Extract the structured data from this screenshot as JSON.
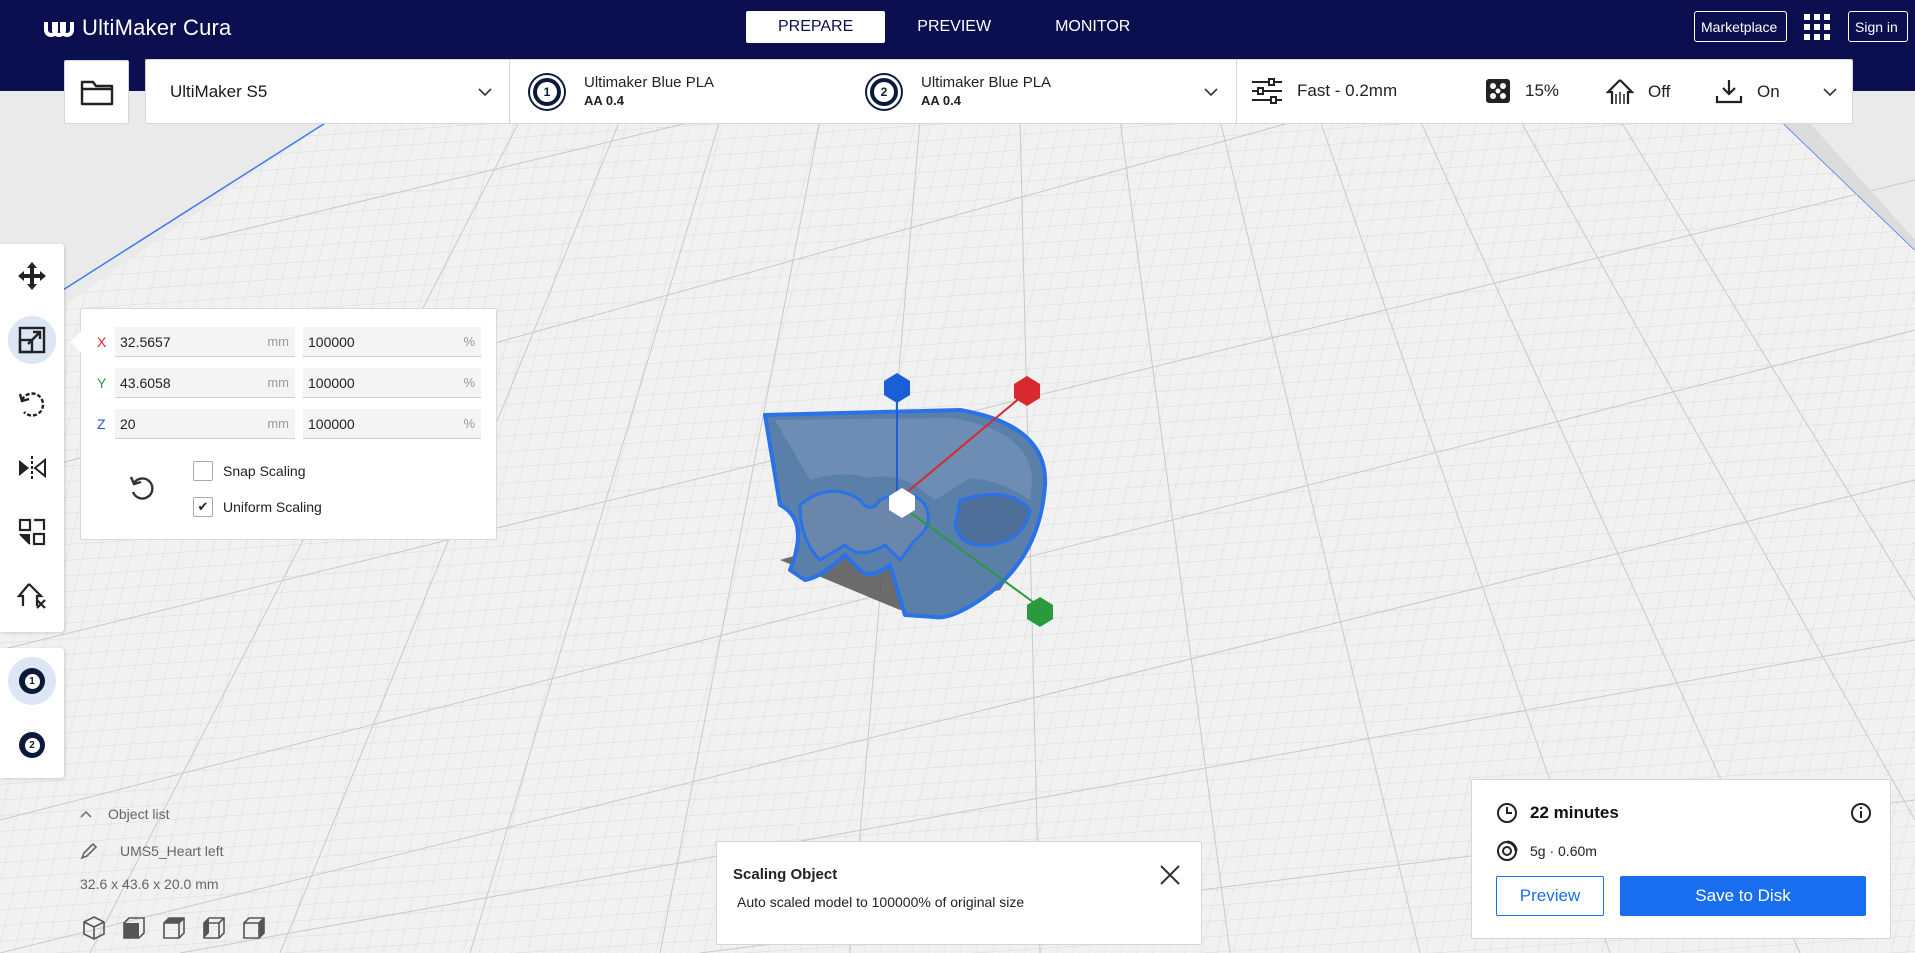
{
  "app": {
    "title": "UltiMaker Cura"
  },
  "stages": [
    "PREPARE",
    "PREVIEW",
    "MONITOR"
  ],
  "header": {
    "marketplace": "Marketplace",
    "sign_in": "Sign in"
  },
  "printer": {
    "name": "UltiMaker S5"
  },
  "extruders": [
    {
      "number": "1",
      "material": "Ultimaker Blue PLA",
      "core": "AA 0.4"
    },
    {
      "number": "2",
      "material": "Ultimaker Blue PLA",
      "core": "AA 0.4"
    }
  ],
  "print_settings": {
    "profile": "Fast - 0.2mm",
    "infill": "15%",
    "support": "Off",
    "adhesion": "On"
  },
  "toolbar": {
    "tools": [
      "move-tool",
      "scale-tool",
      "rotate-tool",
      "mirror-tool",
      "per-model-settings-tool",
      "support-blocker-tool"
    ],
    "active_tool": "scale-tool",
    "extruder_buttons": [
      "1",
      "2"
    ]
  },
  "scale_panel": {
    "rows": [
      {
        "axis": "X",
        "axis_color": "#d8292f",
        "mm": "32.5657",
        "mm_unit": "mm",
        "percent": "100000",
        "percent_unit": "%"
      },
      {
        "axis": "Y",
        "axis_color": "#2b9a3f",
        "mm": "43.6058",
        "mm_unit": "mm",
        "percent": "100000",
        "percent_unit": "%"
      },
      {
        "axis": "Z",
        "axis_color": "#1a5fd6",
        "mm": "20",
        "mm_unit": "mm",
        "percent": "100000",
        "percent_unit": "%"
      }
    ],
    "snap_scaling": {
      "label": "Snap Scaling",
      "checked": false
    },
    "uniform_scaling": {
      "label": "Uniform Scaling",
      "checked": true,
      "check_glyph": "✔"
    }
  },
  "object_list": {
    "header": "Object list",
    "item": "UMS5_Heart left",
    "dimensions": "32.6 x 43.6 x 20.0 mm"
  },
  "toast": {
    "title": "Scaling Object",
    "message": "Auto scaled model to 100000% of original size"
  },
  "print_estimate": {
    "time": "22 minutes",
    "material": "5g · 0.60m",
    "preview_label": "Preview",
    "save_label": "Save to Disk"
  },
  "colors": {
    "topbar": "#0c0f4f",
    "accent_blue": "#196ef0",
    "model_blue": "#4f78a8"
  }
}
